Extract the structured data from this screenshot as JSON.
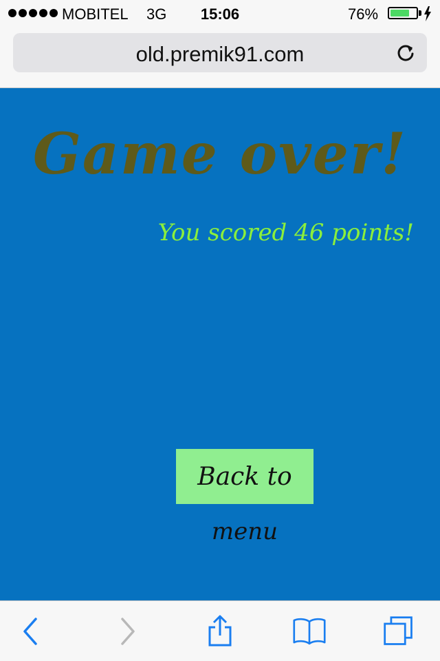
{
  "status_bar": {
    "carrier": "MOBITEL",
    "network": "3G",
    "time": "15:06",
    "battery_percent": "76%",
    "battery_level": 0.76,
    "battery_color": "#4cd964"
  },
  "address_bar": {
    "url": "old.premik91.com",
    "reload_icon": "reload-icon"
  },
  "game": {
    "title": "Game over!",
    "score_message": "You scored 46 points!",
    "back_button_label": "Back to",
    "back_button_label_overflow": "menu",
    "background_color": "#0672c0",
    "title_color": "#5e5a1a",
    "score_color": "#8bef3c",
    "button_color": "#90ee90"
  },
  "toolbar": {
    "icons": [
      "back-icon",
      "forward-icon",
      "share-icon",
      "bookmarks-icon",
      "tabs-icon"
    ],
    "accent_color": "#1a7ef0",
    "disabled_color": "#b8b8b8"
  }
}
